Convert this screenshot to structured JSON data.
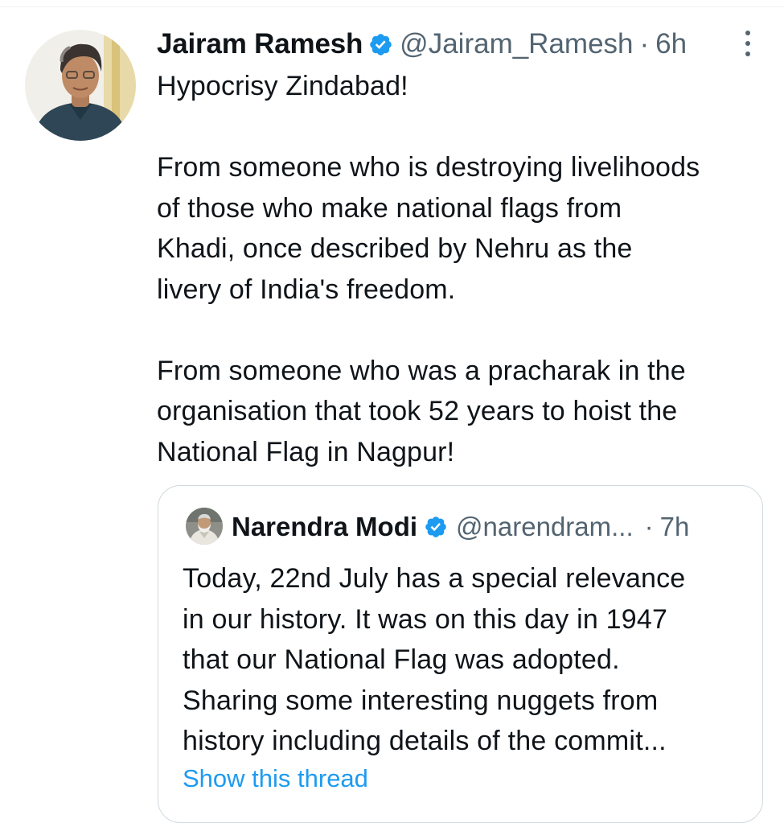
{
  "tweet": {
    "author_name": "Jairam Ramesh",
    "author_handle": "@Jairam_Ramesh",
    "separator": "·",
    "time": "6h",
    "paragraphs": [
      "Hypocrisy Zindabad!",
      "From someone who is destroying livelihoods\nof those who make national flags from\nKhadi, once described by Nehru as the\nlivery of India's freedom.",
      "From someone who was a pracharak in the\norganisation that took 52 years to hoist the\nNational Flag in Nagpur!"
    ],
    "avatar_icon": "profile-photo",
    "verified_icon": "verified-badge-icon",
    "more_icon": "more-options-icon"
  },
  "quoted": {
    "author_name": "Narendra Modi",
    "author_handle": "@narendram...",
    "separator": "·",
    "time": "7h",
    "text": "Today, 22nd July has a special relevance\nin our history. It was on this day in 1947\nthat our National Flag was adopted.\nSharing some interesting nuggets from\nhistory including details of the commit...",
    "show_thread": "Show this thread"
  },
  "colors": {
    "verified": "#1d9bf0",
    "link": "#1d9bf0",
    "secondary_text": "#536471",
    "border": "#cfd9de"
  }
}
